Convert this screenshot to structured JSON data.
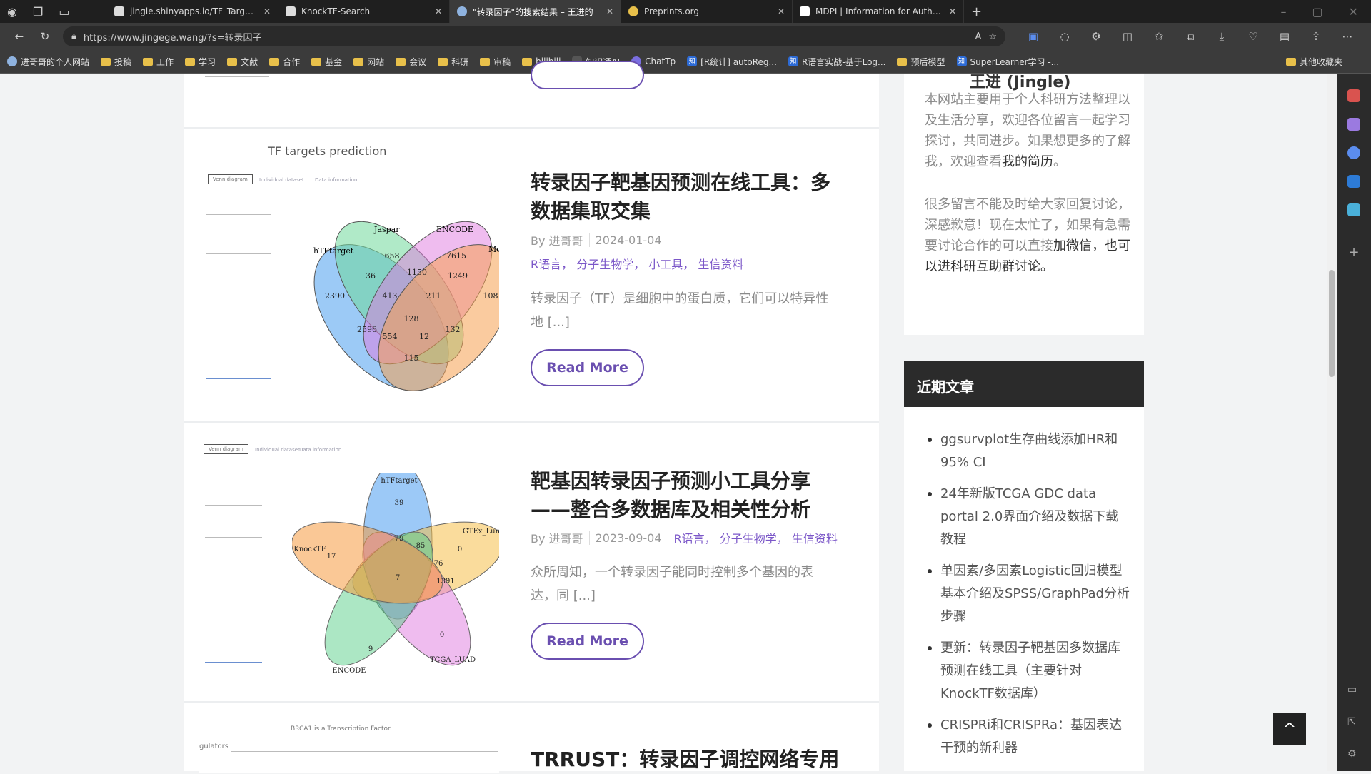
{
  "browser": {
    "tabs": [
      {
        "title": "jingle.shinyapps.io/TF_Target_Fi",
        "active": false
      },
      {
        "title": "KnockTF-Search",
        "active": false
      },
      {
        "title": "\"转录因子\"的搜索结果 – 王进的",
        "active": true
      },
      {
        "title": "Preprints.org",
        "active": false
      },
      {
        "title": "MDPI | Information for Authors",
        "active": false
      }
    ],
    "url": "https://www.jingege.wang/?s=转录因子",
    "bookmarks": [
      "进哥哥的个人网站",
      "投稿",
      "工作",
      "学习",
      "文献",
      "合作",
      "基金",
      "网站",
      "会议",
      "科研",
      "审稿",
      "bilibili",
      "知识通AI",
      "ChatTp",
      "[R统计] autoReg...",
      "R语言实战-基于Log...",
      "预后模型",
      "SuperLearner学习 -..."
    ],
    "other_bookmarks": "其他收藏夹"
  },
  "posts": [
    {
      "thumb_title": "TF targets prediction",
      "thumb_tabs": [
        "Venn diagram",
        "Individual dataset",
        "Data information"
      ],
      "venn_labels": [
        "hTFtarget",
        "Jaspar",
        "ENCODE",
        "Mc"
      ],
      "venn_values": [
        "658",
        "7615",
        "36",
        "1150",
        "1249",
        "2390",
        "413",
        "211",
        "108",
        "128",
        "2596",
        "554",
        "12",
        "132",
        "115"
      ],
      "title": "转录因子靶基因预测在线工具：多数据集取交集",
      "author": "By 进哥哥",
      "date": "2024-01-04",
      "categories": "R语言， 分子生物学， 小工具， 生信资料",
      "excerpt": "转录因子（TF）是细胞中的蛋白质，它们可以特异性地 [...]",
      "read_more": "Read More"
    },
    {
      "thumb_tabs": [
        "Venn diagram",
        "Individual dataset",
        "Data information"
      ],
      "venn_labels": [
        "hTFtarget",
        "GTEx_Lun",
        "TCGA_LUAD",
        "ENCODE",
        "KnockTF"
      ],
      "venn_values": [
        "39",
        "0",
        "17",
        "9",
        "0",
        "7",
        "85",
        "79",
        "76",
        "1391"
      ],
      "title": "靶基因转录因子预测小工具分享——整合多数据库及相关性分析",
      "author": "By 进哥哥",
      "date": "2023-09-04",
      "categories": "R语言， 分子生物学， 生信资料",
      "excerpt": "众所周知，一个转录因子能同时控制多个基因的表达，同 [...]",
      "read_more": "Read More"
    },
    {
      "thumb_caption": "BRCA1 is a Transcription Factor.",
      "thumb_label": "gulators",
      "title": "TRRUST：转录因子调控网络专用"
    }
  ],
  "sidebar": {
    "author_name": "王进 (Jingle)",
    "about_1": "本网站主要用于个人科研方法整理以及生活分享，欢迎各位留言一起学习探讨，共同进步。如果想更多的了解我，欢迎查看",
    "about_link": "我的简历",
    "about_1_end": "。",
    "about_2": "很多留言不能及时给大家回复讨论，深感歉意！现在太忙了，如果有急需要讨论合作的可以直接",
    "about_2_link": "加微信，也可以进科研互助群讨论。",
    "recent_title": "近期文章",
    "recent": [
      "ggsurvplot生存曲线添加HR和95% CI",
      "24年新版TCGA GDC data portal 2.0界面介绍及数据下载教程",
      "单因素/多因素Logistic回归模型基本介绍及SPSS/GraphPad分析步骤",
      "更新：转录因子靶基因多数据库预测在线工具（主要针对KnockTF数据库）",
      "CRISPRi和CRISPRa：基因表达干预的新利器"
    ]
  },
  "back_to_top": "^",
  "colors": {
    "accent": "#6a4fb0",
    "category": "#7b57c8",
    "widget_header": "#2b2b2b"
  }
}
